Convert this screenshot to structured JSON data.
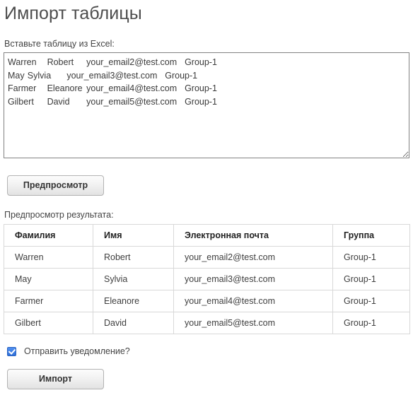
{
  "page": {
    "title": "Импорт таблицы"
  },
  "paste": {
    "label": "Вставьте таблицу из Excel:",
    "placeholder": "",
    "value": "Warren\tRobert\tyour_email2@test.com\tGroup-1\nMay\tSylvia\tyour_email3@test.com\tGroup-1\nFarmer\tEleanore\tyour_email4@test.com\tGroup-1\nGilbert\tDavid\tyour_email5@test.com\tGroup-1"
  },
  "actions": {
    "preview_label": "Предпросмотр",
    "import_label": "Импорт"
  },
  "result": {
    "label": "Предпросмотр результата:",
    "columns": [
      "Фамилия",
      "Имя",
      "Электронная почта",
      "Группа"
    ],
    "rows": [
      [
        "Warren",
        "Robert",
        "your_email2@test.com",
        "Group-1"
      ],
      [
        "May",
        "Sylvia",
        "your_email3@test.com",
        "Group-1"
      ],
      [
        "Farmer",
        "Eleanore",
        "your_email4@test.com",
        "Group-1"
      ],
      [
        "Gilbert",
        "David",
        "your_email5@test.com",
        "Group-1"
      ]
    ]
  },
  "notify": {
    "label": "Отправить уведомление?",
    "checked": true
  },
  "colors": {
    "checkbox_accent": "#3070d8",
    "title_text": "#4d4d4d",
    "body_text": "#3f3f3f",
    "table_border": "#d8d8d8",
    "textarea_border": "#828282",
    "button_border": "#b3b3b3"
  }
}
